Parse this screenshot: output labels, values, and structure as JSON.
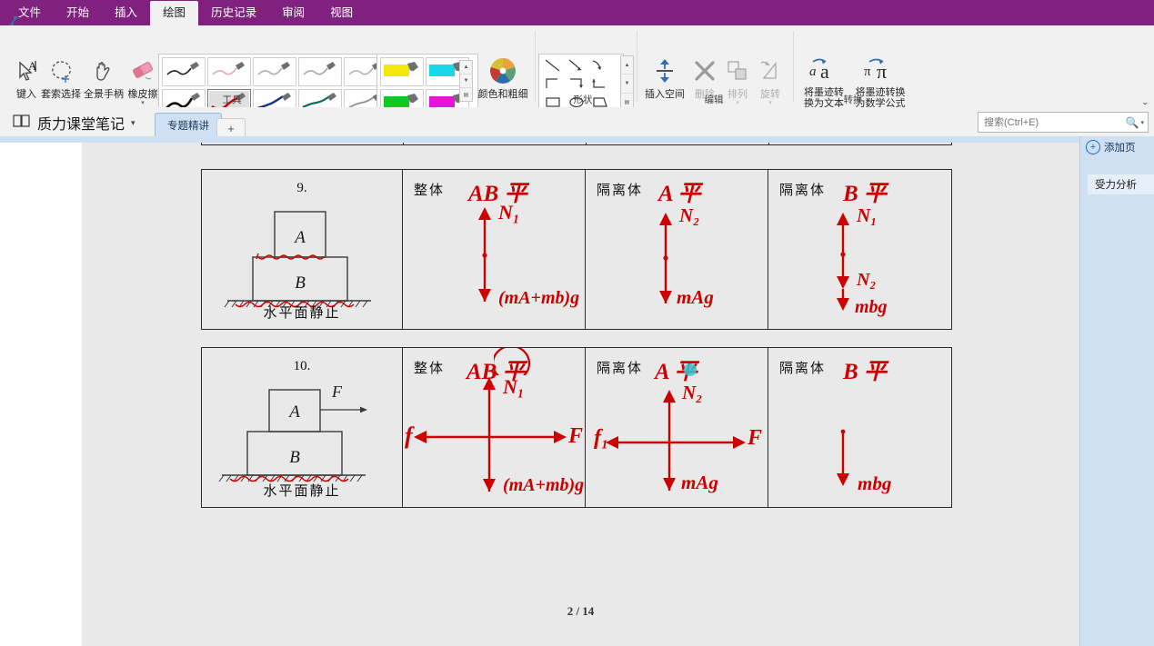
{
  "menu": {
    "tabs": [
      {
        "label": "文件",
        "active": false
      },
      {
        "label": "开始",
        "active": false
      },
      {
        "label": "插入",
        "active": false
      },
      {
        "label": "绘图",
        "active": true
      },
      {
        "label": "历史记录",
        "active": false
      },
      {
        "label": "审阅",
        "active": false
      },
      {
        "label": "视图",
        "active": false
      }
    ]
  },
  "ribbon": {
    "tools_group": {
      "label": "工具",
      "buttons": [
        {
          "name": "type",
          "label": "键入",
          "icon": "text-cursor-icon",
          "disabled": false
        },
        {
          "name": "lasso-select",
          "label": "套索选择",
          "icon": "lasso-icon",
          "disabled": false
        },
        {
          "name": "panoramic-handle",
          "label": "全景手柄",
          "icon": "hand-icon",
          "disabled": false
        },
        {
          "name": "eraser",
          "label": "橡皮擦",
          "icon": "eraser-icon",
          "disabled": false,
          "caret": "▾"
        }
      ],
      "pens": [
        {
          "color": "#222222",
          "selected": false
        },
        {
          "color": "#e5a9b8",
          "selected": false
        },
        {
          "color": "#9a9a9a",
          "selected": false
        },
        {
          "color": "#8f8f8f",
          "selected": false
        },
        {
          "color": "#9c9c9c",
          "selected": false
        },
        {
          "color": "#111111",
          "selected": false
        },
        {
          "color": "#cc0000",
          "selected": true
        },
        {
          "color": "#16348c",
          "selected": false
        },
        {
          "color": "#0d6b5e",
          "selected": false
        },
        {
          "color": "#7a7a7a",
          "selected": false
        }
      ],
      "highlighters": [
        {
          "color": "#f2e80c"
        },
        {
          "color": "#17d8e8"
        },
        {
          "color": "#12c723"
        },
        {
          "color": "#e614d9"
        }
      ],
      "color_thickness": {
        "label": "颜色和粗细",
        "icon": "color-wheel-icon"
      }
    },
    "shapes_group": {
      "label": "形状",
      "items": [
        "line",
        "arrow",
        "curved-arrow",
        "corner",
        "corner-2",
        "elbow",
        "rectangle",
        "ellipse",
        "trapezoid",
        "triangle",
        "diamond",
        "step",
        "axis-plus",
        "axis-double"
      ]
    },
    "edit_group": {
      "label": "编辑",
      "buttons": [
        {
          "name": "insert-space",
          "label": "插入空间",
          "icon": "insert-space-icon",
          "disabled": false
        },
        {
          "name": "delete",
          "label": "删除",
          "icon": "delete-x-icon",
          "disabled": true
        },
        {
          "name": "arrange",
          "label": "排列",
          "icon": "arrange-icon",
          "disabled": true,
          "caret": "▾"
        },
        {
          "name": "rotate",
          "label": "旋转",
          "icon": "rotate-icon",
          "disabled": true,
          "caret": "▾"
        }
      ]
    },
    "convert_group": {
      "label": "转换",
      "buttons": [
        {
          "name": "ink-to-text",
          "label_line1": "将墨迹转",
          "label_line2": "换为文本",
          "icon": "ink-to-text-icon"
        },
        {
          "name": "ink-to-math",
          "label_line1": "将墨迹转换",
          "label_line2": "为数学公式",
          "icon": "ink-to-math-icon"
        }
      ]
    },
    "collapse_caret": "⌃"
  },
  "notebook": {
    "title": "质力课堂笔记",
    "title_caret": "▾",
    "notebook_icon": "notebook-icon",
    "section_tab": "专题精讲",
    "add_section": "+"
  },
  "search": {
    "placeholder": "搜索(Ctrl+E)",
    "value": "",
    "icon": "search-icon",
    "caret": "▾"
  },
  "right_panel": {
    "add_page_label": "添加页",
    "add_page_icon": "plus-circle-icon",
    "pages": [
      "受力分析"
    ],
    "expand_icon": "expand-arrows-icon",
    "scroll_up_icon": "▲"
  },
  "page": {
    "page_indicator": "2 / 14",
    "table_rows": [
      {
        "number": "9.",
        "caption": "水平面静止",
        "diagram": {
          "top_block": "A",
          "bottom_block": "B",
          "force_label": ""
        },
        "cells": [
          {
            "header_print": "整体",
            "header_ink": "AB 平",
            "circled": false,
            "forces": [
              {
                "dir": "up",
                "label": "N₁"
              },
              {
                "dir": "down",
                "label": "(mA+mb)g"
              }
            ]
          },
          {
            "header_print": "隔离体",
            "header_ink": "A 平",
            "circled": false,
            "forces": [
              {
                "dir": "up",
                "label": "N₂"
              },
              {
                "dir": "down",
                "label": "mAg"
              }
            ]
          },
          {
            "header_print": "隔离体",
            "header_ink": "B 平",
            "circled": false,
            "forces": [
              {
                "dir": "up",
                "label": "N₁"
              },
              {
                "dir": "down",
                "label": "N₂"
              },
              {
                "dir": "down",
                "label": "mbg"
              }
            ]
          }
        ]
      },
      {
        "number": "10.",
        "caption": "水平面静止",
        "diagram": {
          "top_block": "A",
          "bottom_block": "B",
          "force_label": "F"
        },
        "cells": [
          {
            "header_print": "整体",
            "header_ink": "AB 平",
            "circled": true,
            "forces": [
              {
                "dir": "up",
                "label": "N₁"
              },
              {
                "dir": "left",
                "label": "f"
              },
              {
                "dir": "right",
                "label": "F"
              },
              {
                "dir": "down",
                "label": "(mA+mb)g"
              }
            ]
          },
          {
            "header_print": "隔离体",
            "header_ink": "A 平",
            "circled": false,
            "has_cursor": true,
            "forces": [
              {
                "dir": "up",
                "label": "N₂"
              },
              {
                "dir": "left",
                "label": "f₁"
              },
              {
                "dir": "right",
                "label": "F"
              },
              {
                "dir": "down",
                "label": "mAg"
              }
            ]
          },
          {
            "header_print": "隔离体",
            "header_ink": "B 平",
            "circled": false,
            "forces": [
              {
                "dir": "down",
                "label": "mbg"
              }
            ]
          }
        ]
      }
    ]
  },
  "colors": {
    "brand_purple": "#80207f",
    "ink_red": "#cc0000",
    "panel_blue": "#cfe0f2",
    "canvas_gray": "#e9e9e9",
    "cursor_cyan": "#35c4d6"
  }
}
